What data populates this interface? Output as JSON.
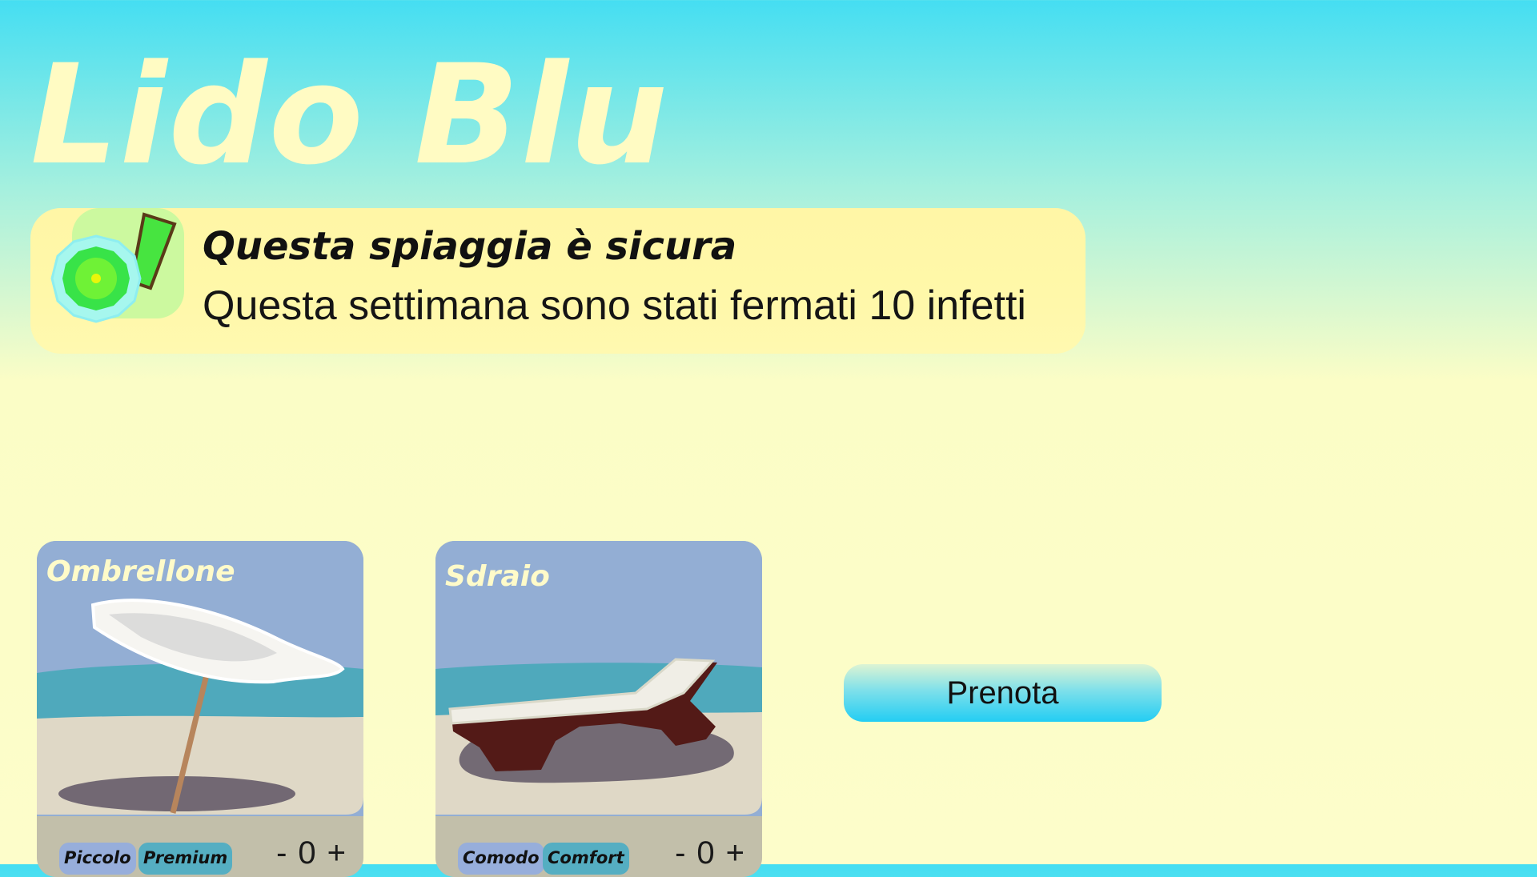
{
  "app": {
    "title": "Lido Blu"
  },
  "banner": {
    "title": "Questa spiaggia è sicura",
    "text": "Questa settimana sono stati fermati 10 infetti"
  },
  "items": [
    {
      "name": "Ombrellone",
      "tags": [
        "Piccolo",
        "Premium"
      ],
      "minus": "-",
      "quantity": "0",
      "plus": "+"
    },
    {
      "name": "Sdraio",
      "tags": [
        "Comodo",
        "Comfort"
      ],
      "minus": "-",
      "quantity": "0",
      "plus": "+"
    }
  ],
  "actions": {
    "book_label": "Prenota"
  },
  "colors": {
    "sky": "#93aed4",
    "sea": "#4fa9bc",
    "sand": "#dfd8c6",
    "accent": "#23cdf3",
    "safe": "#4dea3c"
  }
}
